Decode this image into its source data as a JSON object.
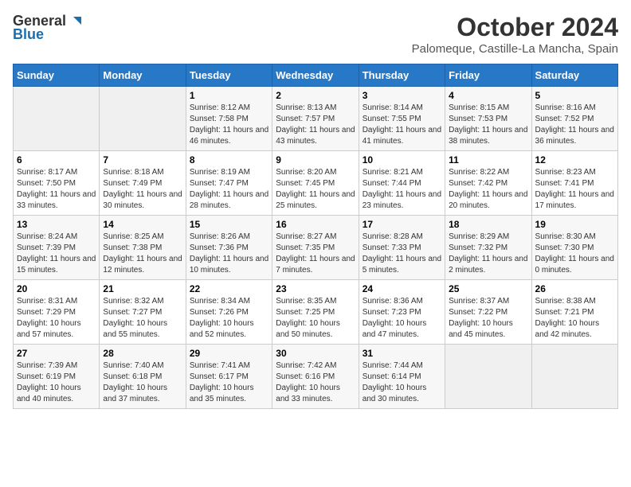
{
  "logo": {
    "general": "General",
    "blue": "Blue"
  },
  "title": {
    "month": "October 2024",
    "location": "Palomeque, Castille-La Mancha, Spain"
  },
  "headers": [
    "Sunday",
    "Monday",
    "Tuesday",
    "Wednesday",
    "Thursday",
    "Friday",
    "Saturday"
  ],
  "weeks": [
    [
      {
        "num": "",
        "info": ""
      },
      {
        "num": "",
        "info": ""
      },
      {
        "num": "1",
        "info": "Sunrise: 8:12 AM\nSunset: 7:58 PM\nDaylight: 11 hours and 46 minutes."
      },
      {
        "num": "2",
        "info": "Sunrise: 8:13 AM\nSunset: 7:57 PM\nDaylight: 11 hours and 43 minutes."
      },
      {
        "num": "3",
        "info": "Sunrise: 8:14 AM\nSunset: 7:55 PM\nDaylight: 11 hours and 41 minutes."
      },
      {
        "num": "4",
        "info": "Sunrise: 8:15 AM\nSunset: 7:53 PM\nDaylight: 11 hours and 38 minutes."
      },
      {
        "num": "5",
        "info": "Sunrise: 8:16 AM\nSunset: 7:52 PM\nDaylight: 11 hours and 36 minutes."
      }
    ],
    [
      {
        "num": "6",
        "info": "Sunrise: 8:17 AM\nSunset: 7:50 PM\nDaylight: 11 hours and 33 minutes."
      },
      {
        "num": "7",
        "info": "Sunrise: 8:18 AM\nSunset: 7:49 PM\nDaylight: 11 hours and 30 minutes."
      },
      {
        "num": "8",
        "info": "Sunrise: 8:19 AM\nSunset: 7:47 PM\nDaylight: 11 hours and 28 minutes."
      },
      {
        "num": "9",
        "info": "Sunrise: 8:20 AM\nSunset: 7:45 PM\nDaylight: 11 hours and 25 minutes."
      },
      {
        "num": "10",
        "info": "Sunrise: 8:21 AM\nSunset: 7:44 PM\nDaylight: 11 hours and 23 minutes."
      },
      {
        "num": "11",
        "info": "Sunrise: 8:22 AM\nSunset: 7:42 PM\nDaylight: 11 hours and 20 minutes."
      },
      {
        "num": "12",
        "info": "Sunrise: 8:23 AM\nSunset: 7:41 PM\nDaylight: 11 hours and 17 minutes."
      }
    ],
    [
      {
        "num": "13",
        "info": "Sunrise: 8:24 AM\nSunset: 7:39 PM\nDaylight: 11 hours and 15 minutes."
      },
      {
        "num": "14",
        "info": "Sunrise: 8:25 AM\nSunset: 7:38 PM\nDaylight: 11 hours and 12 minutes."
      },
      {
        "num": "15",
        "info": "Sunrise: 8:26 AM\nSunset: 7:36 PM\nDaylight: 11 hours and 10 minutes."
      },
      {
        "num": "16",
        "info": "Sunrise: 8:27 AM\nSunset: 7:35 PM\nDaylight: 11 hours and 7 minutes."
      },
      {
        "num": "17",
        "info": "Sunrise: 8:28 AM\nSunset: 7:33 PM\nDaylight: 11 hours and 5 minutes."
      },
      {
        "num": "18",
        "info": "Sunrise: 8:29 AM\nSunset: 7:32 PM\nDaylight: 11 hours and 2 minutes."
      },
      {
        "num": "19",
        "info": "Sunrise: 8:30 AM\nSunset: 7:30 PM\nDaylight: 11 hours and 0 minutes."
      }
    ],
    [
      {
        "num": "20",
        "info": "Sunrise: 8:31 AM\nSunset: 7:29 PM\nDaylight: 10 hours and 57 minutes."
      },
      {
        "num": "21",
        "info": "Sunrise: 8:32 AM\nSunset: 7:27 PM\nDaylight: 10 hours and 55 minutes."
      },
      {
        "num": "22",
        "info": "Sunrise: 8:34 AM\nSunset: 7:26 PM\nDaylight: 10 hours and 52 minutes."
      },
      {
        "num": "23",
        "info": "Sunrise: 8:35 AM\nSunset: 7:25 PM\nDaylight: 10 hours and 50 minutes."
      },
      {
        "num": "24",
        "info": "Sunrise: 8:36 AM\nSunset: 7:23 PM\nDaylight: 10 hours and 47 minutes."
      },
      {
        "num": "25",
        "info": "Sunrise: 8:37 AM\nSunset: 7:22 PM\nDaylight: 10 hours and 45 minutes."
      },
      {
        "num": "26",
        "info": "Sunrise: 8:38 AM\nSunset: 7:21 PM\nDaylight: 10 hours and 42 minutes."
      }
    ],
    [
      {
        "num": "27",
        "info": "Sunrise: 7:39 AM\nSunset: 6:19 PM\nDaylight: 10 hours and 40 minutes."
      },
      {
        "num": "28",
        "info": "Sunrise: 7:40 AM\nSunset: 6:18 PM\nDaylight: 10 hours and 37 minutes."
      },
      {
        "num": "29",
        "info": "Sunrise: 7:41 AM\nSunset: 6:17 PM\nDaylight: 10 hours and 35 minutes."
      },
      {
        "num": "30",
        "info": "Sunrise: 7:42 AM\nSunset: 6:16 PM\nDaylight: 10 hours and 33 minutes."
      },
      {
        "num": "31",
        "info": "Sunrise: 7:44 AM\nSunset: 6:14 PM\nDaylight: 10 hours and 30 minutes."
      },
      {
        "num": "",
        "info": ""
      },
      {
        "num": "",
        "info": ""
      }
    ]
  ]
}
